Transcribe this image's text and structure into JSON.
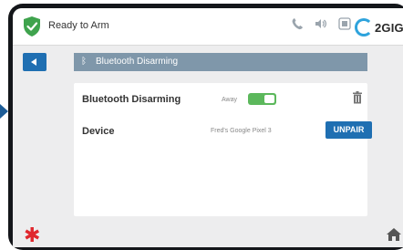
{
  "status_bar": {
    "status_text": "Ready to Arm",
    "icons": [
      "shield-check-icon",
      "phone-icon",
      "speaker-icon",
      "wifi-icon"
    ],
    "brand": "2GIG"
  },
  "header": {
    "title": "Bluetooth Disarming",
    "icon": "bluetooth-icon"
  },
  "settings": {
    "bluetooth_disarming_label": "Bluetooth Disarming",
    "away_label": "Away",
    "toggle_state": "on",
    "device_label": "Device",
    "device_value": "Fred's Google Pixel 3",
    "unpair_label": "UNPAIR"
  },
  "bottom_bar": {
    "left_icon": "asterisk",
    "right_icon": "home-icon"
  },
  "colors": {
    "accent": "#1f6fb2",
    "toggle_on": "#5cb85c",
    "header_bar": "#7f97aa",
    "shield": "#3fa34d",
    "emergency": "#e0272d"
  }
}
